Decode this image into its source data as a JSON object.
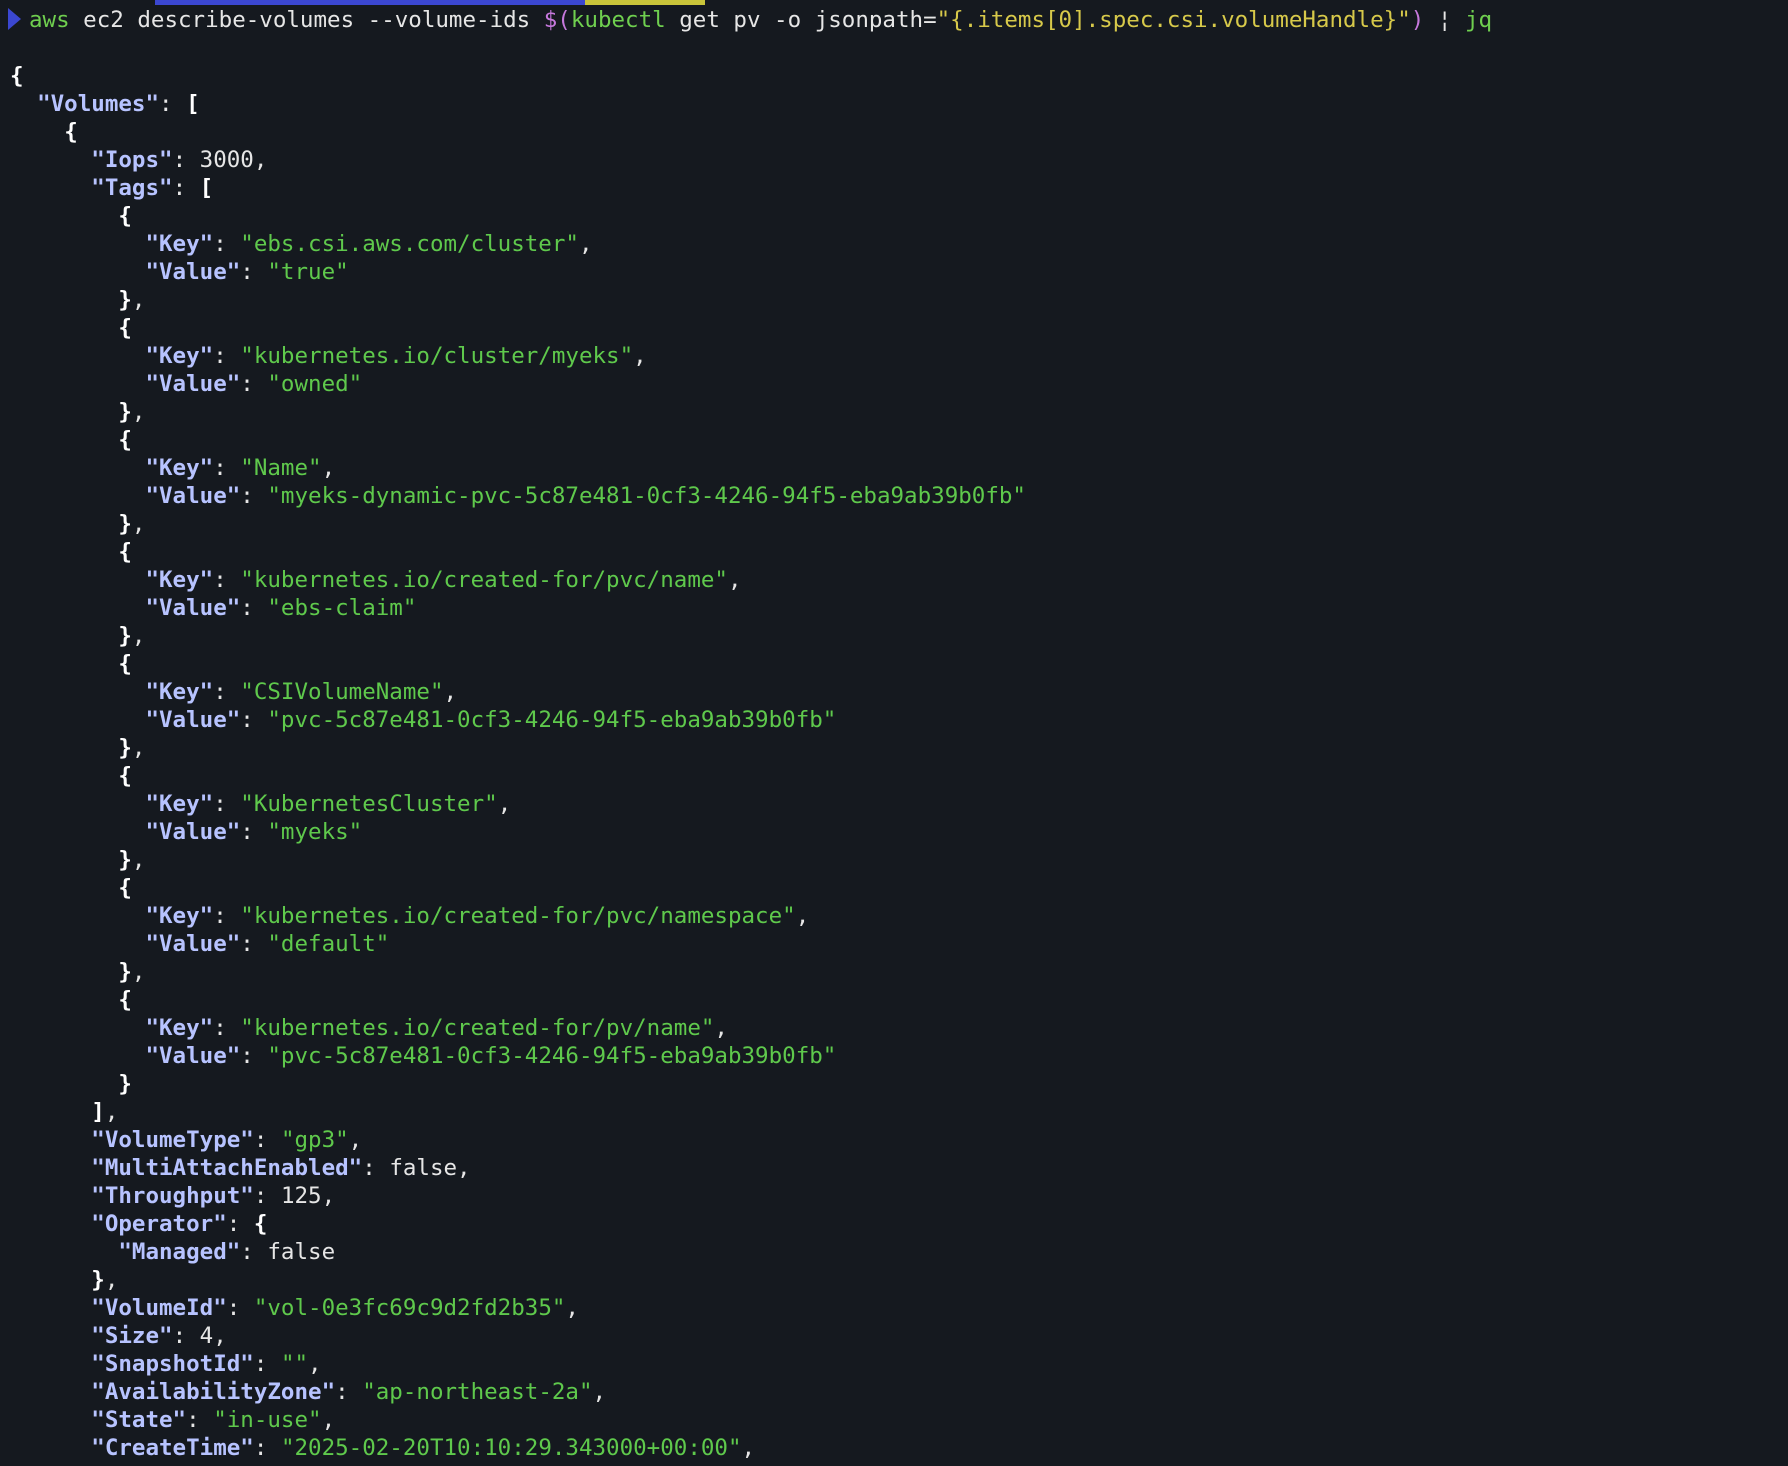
{
  "terminal": {
    "command": {
      "program": "aws",
      "args": " ec2 describe-volumes --volume-ids ",
      "subshell_open": "$(",
      "subcommand": "kubectl",
      "subargs": " get pv -o jsonpath=",
      "jsonpath": "\"{.items[0].spec.csi.volumeHandle}\"",
      "subshell_close": ")",
      "pipe": " ¦ ",
      "filter": "jq"
    },
    "json_lines": [
      {
        "i": 0,
        "t": [
          [
            "b",
            "{"
          ]
        ]
      },
      {
        "i": 1,
        "t": [
          [
            "k",
            "\"Volumes\""
          ],
          [
            "p",
            ": "
          ],
          [
            "b",
            "["
          ]
        ]
      },
      {
        "i": 2,
        "t": [
          [
            "b",
            "{"
          ]
        ]
      },
      {
        "i": 3,
        "t": [
          [
            "k",
            "\"Iops\""
          ],
          [
            "p",
            ": "
          ],
          [
            "l",
            "3000"
          ],
          [
            "p",
            ","
          ]
        ]
      },
      {
        "i": 3,
        "t": [
          [
            "k",
            "\"Tags\""
          ],
          [
            "p",
            ": "
          ],
          [
            "b",
            "["
          ]
        ]
      },
      {
        "i": 4,
        "t": [
          [
            "b",
            "{"
          ]
        ]
      },
      {
        "i": 5,
        "t": [
          [
            "k",
            "\"Key\""
          ],
          [
            "p",
            ": "
          ],
          [
            "s",
            "\"ebs.csi.aws.com/cluster\""
          ],
          [
            "p",
            ","
          ]
        ]
      },
      {
        "i": 5,
        "t": [
          [
            "k",
            "\"Value\""
          ],
          [
            "p",
            ": "
          ],
          [
            "s",
            "\"true\""
          ]
        ]
      },
      {
        "i": 4,
        "t": [
          [
            "b",
            "}"
          ],
          [
            "p",
            ","
          ]
        ]
      },
      {
        "i": 4,
        "t": [
          [
            "b",
            "{"
          ]
        ]
      },
      {
        "i": 5,
        "t": [
          [
            "k",
            "\"Key\""
          ],
          [
            "p",
            ": "
          ],
          [
            "s",
            "\"kubernetes.io/cluster/myeks\""
          ],
          [
            "p",
            ","
          ]
        ]
      },
      {
        "i": 5,
        "t": [
          [
            "k",
            "\"Value\""
          ],
          [
            "p",
            ": "
          ],
          [
            "s",
            "\"owned\""
          ]
        ]
      },
      {
        "i": 4,
        "t": [
          [
            "b",
            "}"
          ],
          [
            "p",
            ","
          ]
        ]
      },
      {
        "i": 4,
        "t": [
          [
            "b",
            "{"
          ]
        ]
      },
      {
        "i": 5,
        "t": [
          [
            "k",
            "\"Key\""
          ],
          [
            "p",
            ": "
          ],
          [
            "s",
            "\"Name\""
          ],
          [
            "p",
            ","
          ]
        ]
      },
      {
        "i": 5,
        "t": [
          [
            "k",
            "\"Value\""
          ],
          [
            "p",
            ": "
          ],
          [
            "s",
            "\"myeks-dynamic-pvc-5c87e481-0cf3-4246-94f5-eba9ab39b0fb\""
          ]
        ]
      },
      {
        "i": 4,
        "t": [
          [
            "b",
            "}"
          ],
          [
            "p",
            ","
          ]
        ]
      },
      {
        "i": 4,
        "t": [
          [
            "b",
            "{"
          ]
        ]
      },
      {
        "i": 5,
        "t": [
          [
            "k",
            "\"Key\""
          ],
          [
            "p",
            ": "
          ],
          [
            "s",
            "\"kubernetes.io/created-for/pvc/name\""
          ],
          [
            "p",
            ","
          ]
        ]
      },
      {
        "i": 5,
        "t": [
          [
            "k",
            "\"Value\""
          ],
          [
            "p",
            ": "
          ],
          [
            "s",
            "\"ebs-claim\""
          ]
        ]
      },
      {
        "i": 4,
        "t": [
          [
            "b",
            "}"
          ],
          [
            "p",
            ","
          ]
        ]
      },
      {
        "i": 4,
        "t": [
          [
            "b",
            "{"
          ]
        ]
      },
      {
        "i": 5,
        "t": [
          [
            "k",
            "\"Key\""
          ],
          [
            "p",
            ": "
          ],
          [
            "s",
            "\"CSIVolumeName\""
          ],
          [
            "p",
            ","
          ]
        ]
      },
      {
        "i": 5,
        "t": [
          [
            "k",
            "\"Value\""
          ],
          [
            "p",
            ": "
          ],
          [
            "s",
            "\"pvc-5c87e481-0cf3-4246-94f5-eba9ab39b0fb\""
          ]
        ]
      },
      {
        "i": 4,
        "t": [
          [
            "b",
            "}"
          ],
          [
            "p",
            ","
          ]
        ]
      },
      {
        "i": 4,
        "t": [
          [
            "b",
            "{"
          ]
        ]
      },
      {
        "i": 5,
        "t": [
          [
            "k",
            "\"Key\""
          ],
          [
            "p",
            ": "
          ],
          [
            "s",
            "\"KubernetesCluster\""
          ],
          [
            "p",
            ","
          ]
        ]
      },
      {
        "i": 5,
        "t": [
          [
            "k",
            "\"Value\""
          ],
          [
            "p",
            ": "
          ],
          [
            "s",
            "\"myeks\""
          ]
        ]
      },
      {
        "i": 4,
        "t": [
          [
            "b",
            "}"
          ],
          [
            "p",
            ","
          ]
        ]
      },
      {
        "i": 4,
        "t": [
          [
            "b",
            "{"
          ]
        ]
      },
      {
        "i": 5,
        "t": [
          [
            "k",
            "\"Key\""
          ],
          [
            "p",
            ": "
          ],
          [
            "s",
            "\"kubernetes.io/created-for/pvc/namespace\""
          ],
          [
            "p",
            ","
          ]
        ]
      },
      {
        "i": 5,
        "t": [
          [
            "k",
            "\"Value\""
          ],
          [
            "p",
            ": "
          ],
          [
            "s",
            "\"default\""
          ]
        ]
      },
      {
        "i": 4,
        "t": [
          [
            "b",
            "}"
          ],
          [
            "p",
            ","
          ]
        ]
      },
      {
        "i": 4,
        "t": [
          [
            "b",
            "{"
          ]
        ]
      },
      {
        "i": 5,
        "t": [
          [
            "k",
            "\"Key\""
          ],
          [
            "p",
            ": "
          ],
          [
            "s",
            "\"kubernetes.io/created-for/pv/name\""
          ],
          [
            "p",
            ","
          ]
        ]
      },
      {
        "i": 5,
        "t": [
          [
            "k",
            "\"Value\""
          ],
          [
            "p",
            ": "
          ],
          [
            "s",
            "\"pvc-5c87e481-0cf3-4246-94f5-eba9ab39b0fb\""
          ]
        ]
      },
      {
        "i": 4,
        "t": [
          [
            "b",
            "}"
          ]
        ]
      },
      {
        "i": 3,
        "t": [
          [
            "b",
            "]"
          ],
          [
            "p",
            ","
          ]
        ]
      },
      {
        "i": 3,
        "t": [
          [
            "k",
            "\"VolumeType\""
          ],
          [
            "p",
            ": "
          ],
          [
            "s",
            "\"gp3\""
          ],
          [
            "p",
            ","
          ]
        ]
      },
      {
        "i": 3,
        "t": [
          [
            "k",
            "\"MultiAttachEnabled\""
          ],
          [
            "p",
            ": "
          ],
          [
            "l",
            "false"
          ],
          [
            "p",
            ","
          ]
        ]
      },
      {
        "i": 3,
        "t": [
          [
            "k",
            "\"Throughput\""
          ],
          [
            "p",
            ": "
          ],
          [
            "l",
            "125"
          ],
          [
            "p",
            ","
          ]
        ]
      },
      {
        "i": 3,
        "t": [
          [
            "k",
            "\"Operator\""
          ],
          [
            "p",
            ": "
          ],
          [
            "b",
            "{"
          ]
        ]
      },
      {
        "i": 4,
        "t": [
          [
            "k",
            "\"Managed\""
          ],
          [
            "p",
            ": "
          ],
          [
            "l",
            "false"
          ]
        ]
      },
      {
        "i": 3,
        "t": [
          [
            "b",
            "}"
          ],
          [
            "p",
            ","
          ]
        ]
      },
      {
        "i": 3,
        "t": [
          [
            "k",
            "\"VolumeId\""
          ],
          [
            "p",
            ": "
          ],
          [
            "s",
            "\"vol-0e3fc69c9d2fd2b35\""
          ],
          [
            "p",
            ","
          ]
        ]
      },
      {
        "i": 3,
        "t": [
          [
            "k",
            "\"Size\""
          ],
          [
            "p",
            ": "
          ],
          [
            "l",
            "4"
          ],
          [
            "p",
            ","
          ]
        ]
      },
      {
        "i": 3,
        "t": [
          [
            "k",
            "\"SnapshotId\""
          ],
          [
            "p",
            ": "
          ],
          [
            "s",
            "\"\""
          ],
          [
            "p",
            ","
          ]
        ]
      },
      {
        "i": 3,
        "t": [
          [
            "k",
            "\"AvailabilityZone\""
          ],
          [
            "p",
            ": "
          ],
          [
            "s",
            "\"ap-northeast-2a\""
          ],
          [
            "p",
            ","
          ]
        ]
      },
      {
        "i": 3,
        "t": [
          [
            "k",
            "\"State\""
          ],
          [
            "p",
            ": "
          ],
          [
            "s",
            "\"in-use\""
          ],
          [
            "p",
            ","
          ]
        ]
      },
      {
        "i": 3,
        "t": [
          [
            "k",
            "\"CreateTime\""
          ],
          [
            "p",
            ": "
          ],
          [
            "s",
            "\"2025-02-20T10:10:29.343000+00:00\""
          ],
          [
            "p",
            ","
          ]
        ]
      }
    ]
  },
  "colors": {
    "background": "#15191f",
    "prompt_accent": "#3b47d1",
    "prompt_secondary": "#c9c43a",
    "json_key": "#b7c3ff",
    "json_string": "#5fc94c",
    "json_literal": "#e6e6e6",
    "command_program": "#6fcf4f",
    "subshell": "#c678dd",
    "quoted_arg": "#d7c94a"
  },
  "icons": {
    "prompt": "prompt-arrow-icon"
  }
}
